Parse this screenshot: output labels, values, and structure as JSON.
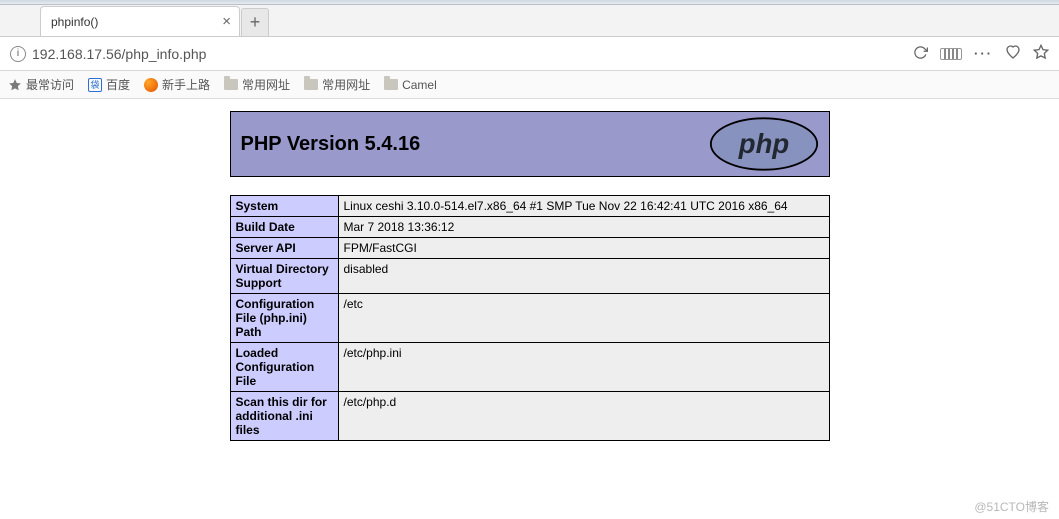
{
  "browser": {
    "tab_title": "phpinfo()",
    "url": "192.168.17.56/php_info.php",
    "bookmarks": [
      {
        "label": "最常访问",
        "icon": "star"
      },
      {
        "label": "百度",
        "icon": "baidu"
      },
      {
        "label": "新手上路",
        "icon": "firefox"
      },
      {
        "label": "常用网址",
        "icon": "folder"
      },
      {
        "label": "常用网址",
        "icon": "folder"
      },
      {
        "label": "Camel",
        "icon": "folder"
      }
    ]
  },
  "phpinfo": {
    "title": "PHP Version 5.4.16",
    "logo_text": "php",
    "rows": [
      {
        "k": "System",
        "v": "Linux ceshi 3.10.0-514.el7.x86_64 #1 SMP Tue Nov 22 16:42:41 UTC 2016 x86_64"
      },
      {
        "k": "Build Date",
        "v": "Mar 7 2018 13:36:12"
      },
      {
        "k": "Server API",
        "v": "FPM/FastCGI"
      },
      {
        "k": "Virtual Directory Support",
        "v": "disabled"
      },
      {
        "k": "Configuration File (php.ini) Path",
        "v": "/etc"
      },
      {
        "k": "Loaded Configuration File",
        "v": "/etc/php.ini"
      },
      {
        "k": "Scan this dir for additional .ini files",
        "v": "/etc/php.d"
      }
    ]
  },
  "watermark": "@51CTO博客"
}
